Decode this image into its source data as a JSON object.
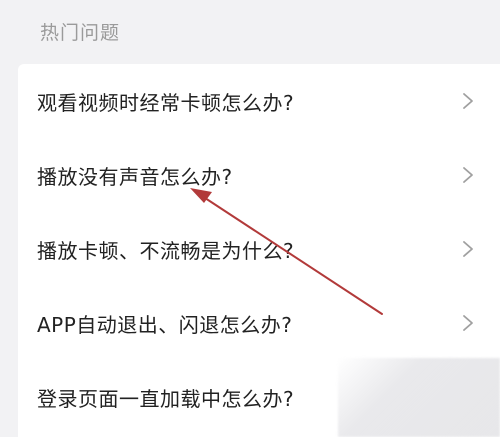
{
  "section_title": "热门问题",
  "faq_items": [
    {
      "label": "观看视频时经常卡顿怎么办?",
      "icon": "chevron-right-icon"
    },
    {
      "label": "播放没有声音怎么办?",
      "icon": "chevron-right-icon"
    },
    {
      "label": "播放卡顿、不流畅是为什么?",
      "icon": "chevron-right-icon"
    },
    {
      "label": "APP自动退出、闪退怎么办?",
      "icon": "chevron-right-icon"
    },
    {
      "label": "登录页面一直加载中怎么办?",
      "icon": "chevron-right-icon"
    }
  ],
  "colors": {
    "background": "#f2f2f4",
    "card": "#ffffff",
    "text": "#222222",
    "title": "#9a9a9a",
    "chevron": "#a0a0a0",
    "annotation_arrow": "#b23a3a"
  }
}
